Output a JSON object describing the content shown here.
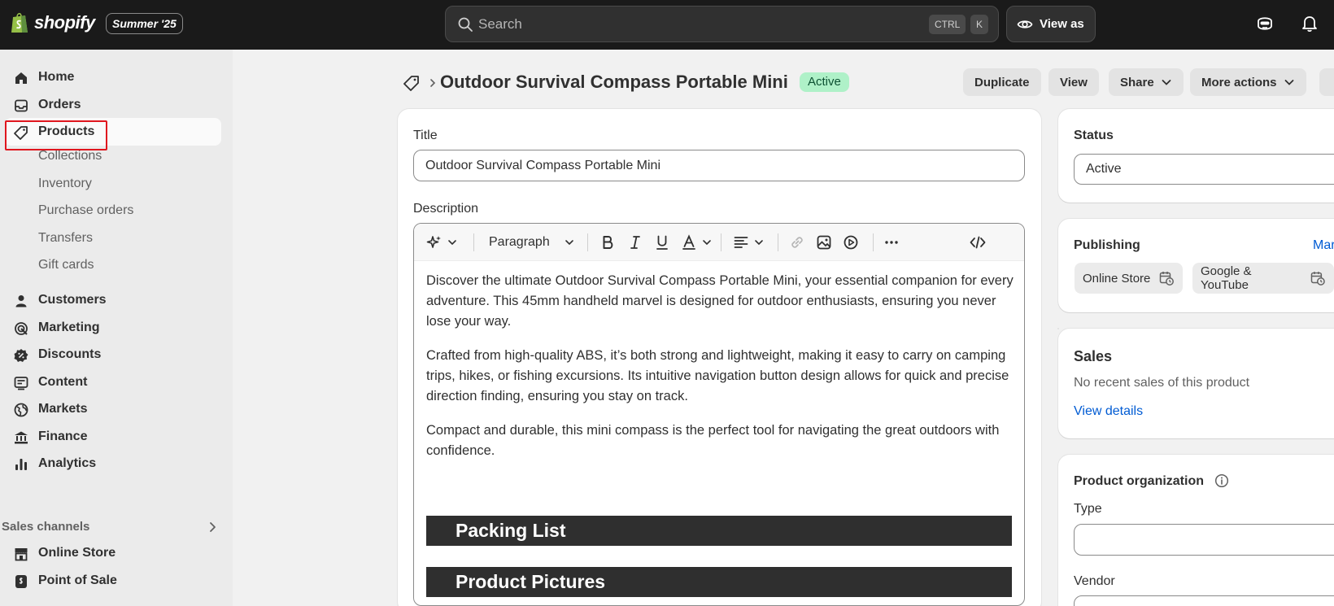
{
  "topbar": {
    "logo_text": "shopify",
    "edition": "Summer '25",
    "search_placeholder": "Search",
    "shortcut_ctrl": "CTRL",
    "shortcut_k": "K",
    "view_as": "View as"
  },
  "sidebar": {
    "items": [
      {
        "label": "Home",
        "icon": "home-icon"
      },
      {
        "label": "Orders",
        "icon": "inbox-icon"
      },
      {
        "label": "Products",
        "icon": "tag-icon"
      },
      {
        "label": "Customers",
        "icon": "person-icon"
      },
      {
        "label": "Marketing",
        "icon": "target-icon"
      },
      {
        "label": "Discounts",
        "icon": "discount-icon"
      },
      {
        "label": "Content",
        "icon": "content-icon"
      },
      {
        "label": "Markets",
        "icon": "globe-icon"
      },
      {
        "label": "Finance",
        "icon": "bank-icon"
      },
      {
        "label": "Analytics",
        "icon": "bar-chart-icon"
      }
    ],
    "product_subitems": [
      "Collections",
      "Inventory",
      "Purchase orders",
      "Transfers",
      "Gift cards"
    ],
    "sales_channels_label": "Sales channels",
    "channels": [
      {
        "label": "Online Store",
        "icon": "store-icon"
      },
      {
        "label": "Point of Sale",
        "icon": "pos-icon"
      }
    ]
  },
  "header": {
    "title": "Outdoor Survival Compass Portable Mini",
    "status_badge": "Active",
    "buttons": {
      "duplicate": "Duplicate",
      "view": "View",
      "share": "Share",
      "more_actions": "More actions"
    }
  },
  "product_form": {
    "title_label": "Title",
    "title_value": "Outdoor Survival Compass Portable Mini",
    "description_label": "Description",
    "toolbar_paragraph": "Paragraph",
    "description_paragraphs": [
      "Discover the ultimate Outdoor Survival Compass Portable Mini, your essential companion for every adventure. This 45mm handheld marvel is designed for outdoor enthusiasts, ensuring you never lose your way.",
      "Crafted from high-quality ABS, it’s both strong and lightweight, making it easy to carry on camping trips, hikes, or fishing excursions. Its intuitive navigation button design allows for quick and precise direction finding, ensuring you stay on track.",
      "Compact and durable, this mini compass is the perfect tool for navigating the great outdoors with confidence."
    ],
    "section_headings": [
      "Packing List",
      "Product Pictures"
    ]
  },
  "status_card": {
    "title": "Status",
    "value": "Active"
  },
  "publishing_card": {
    "title": "Publishing",
    "manage_link": "Mar",
    "channels": [
      "Online Store",
      "Google & YouTube"
    ]
  },
  "sales_card": {
    "title": "Sales",
    "text": "No recent sales of this product",
    "link": "View details"
  },
  "organization_card": {
    "title": "Product organization",
    "type_label": "Type",
    "vendor_label": "Vendor"
  },
  "colors": {
    "topbar": "#1a1a1a",
    "active_badge_bg": "#aff1c8",
    "link": "#005bd3",
    "highlight_outline": "#e0161e"
  }
}
